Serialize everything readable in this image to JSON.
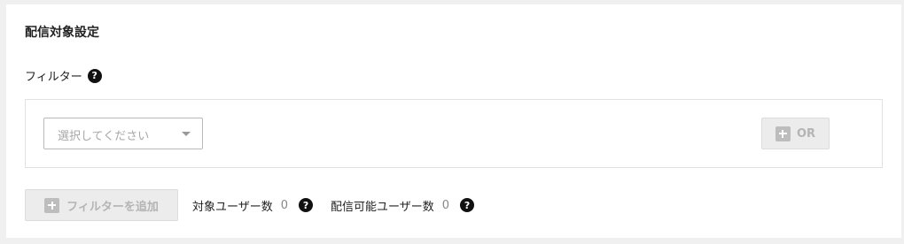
{
  "section": {
    "title": "配信対象設定"
  },
  "filter": {
    "label": "フィルター",
    "help_icon": "question-circle-icon",
    "select_placeholder": "選択してください",
    "or_button_label": "OR"
  },
  "actions": {
    "add_filter_label": "フィルターを追加"
  },
  "stats": {
    "target_users_label": "対象ユーザー数",
    "target_users_value": "0",
    "deliverable_users_label": "配信可能ユーザー数",
    "deliverable_users_value": "0"
  },
  "colors": {
    "disabled_button_bg": "#ececec",
    "disabled_text": "#b4b4b4",
    "help_icon": "#111111"
  }
}
